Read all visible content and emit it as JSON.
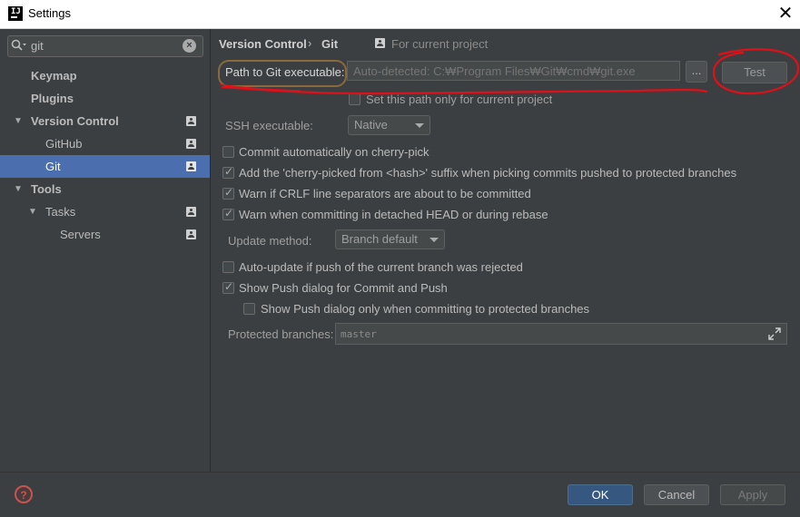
{
  "window": {
    "title": "Settings",
    "app_icon_text": "IJ"
  },
  "search": {
    "value": "git"
  },
  "sidebar": {
    "items": [
      {
        "label": "Keymap",
        "bold": true
      },
      {
        "label": "Plugins",
        "bold": true
      },
      {
        "label": "Version Control",
        "bold": true,
        "expanded": true
      },
      {
        "label": "GitHub"
      },
      {
        "label": "Git",
        "selected": true
      },
      {
        "label": "Tools",
        "bold": true,
        "expanded": true
      },
      {
        "label": "Tasks",
        "expanded": true
      },
      {
        "label": "Servers"
      }
    ]
  },
  "breadcrumb": {
    "parent": "Version Control",
    "separator": "›",
    "current": "Git",
    "scope": "For current project"
  },
  "git": {
    "path_label": "Path to Git executable:",
    "path_placeholder": "Auto-detected: C:₩Program Files₩Git₩cmd₩git.exe",
    "browse_label": "...",
    "test_label": "Test",
    "set_path_only": {
      "label": "Set this path only for current project",
      "checked": false
    },
    "ssh_label": "SSH executable:",
    "ssh_value": "Native",
    "options": [
      {
        "label": "Commit automatically on cherry-pick",
        "checked": false
      },
      {
        "label": "Add the 'cherry-picked from <hash>' suffix when picking commits pushed to protected branches",
        "checked": true
      },
      {
        "label": "Warn if CRLF line separators are about to be committed",
        "checked": true
      },
      {
        "label": "Warn when committing in detached HEAD or during rebase",
        "checked": true
      }
    ],
    "update_method_label": "Update method:",
    "update_method_value": "Branch default",
    "push_options": [
      {
        "label": "Auto-update if push of the current branch was rejected",
        "checked": false
      },
      {
        "label": "Show Push dialog for Commit and Push",
        "checked": true
      },
      {
        "label": "Show Push dialog only when committing to protected branches",
        "checked": false
      }
    ],
    "protected_label": "Protected branches:",
    "protected_value": "master"
  },
  "footer": {
    "help": "?",
    "ok": "OK",
    "cancel": "Cancel",
    "apply": "Apply"
  },
  "colors": {
    "selection": "#4b6eaf",
    "annotation": "#e0101a",
    "ok_button": "#365880"
  },
  "icons": {
    "search": "search-icon",
    "clear": "clear-icon",
    "expand": "expand-icon",
    "project": "project-icon",
    "help": "help-icon"
  }
}
